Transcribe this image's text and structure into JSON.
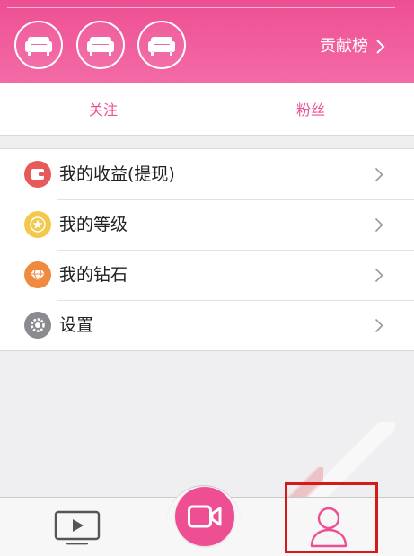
{
  "header": {
    "rank_label": "贡献榜",
    "badges": [
      {
        "icon": "sofa-icon"
      },
      {
        "icon": "sofa-icon"
      },
      {
        "icon": "sofa-icon"
      }
    ]
  },
  "follow_bar": {
    "following_label": "关注",
    "fans_label": "粉丝"
  },
  "menu": {
    "items": [
      {
        "label": "我的收益(提现)",
        "icon": "wallet-icon",
        "color": "#e85a5a"
      },
      {
        "label": "我的等级",
        "icon": "star-icon",
        "color": "#f2c94c"
      },
      {
        "label": "我的钻石",
        "icon": "diamond-icon",
        "color": "#f08a3e"
      },
      {
        "label": "设置",
        "icon": "gear-icon",
        "color": "#8a8a8f"
      }
    ]
  },
  "tabbar": {
    "tabs": [
      {
        "name": "live",
        "icon": "tv-play-icon"
      },
      {
        "name": "record",
        "icon": "video-camera-icon"
      },
      {
        "name": "profile",
        "icon": "person-icon",
        "selected": true
      }
    ]
  },
  "colors": {
    "accent": "#ee4f93",
    "highlight": "#d41a1a"
  }
}
